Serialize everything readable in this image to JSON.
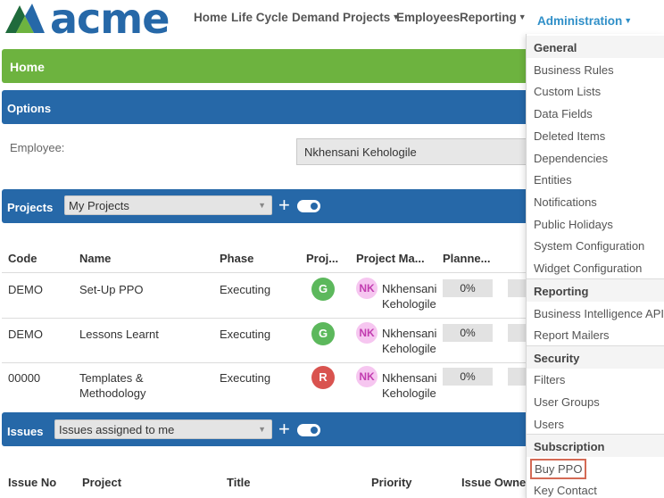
{
  "brand": {
    "logo_text": "acme",
    "logo_icon": "acme-triangle-logo"
  },
  "nav": {
    "home": "Home",
    "life_cycle": "Life Cycle",
    "demand_projects": "Demand Projects",
    "employees": "Employees",
    "reporting": "Reporting",
    "administration": "Administration"
  },
  "home_title": "Home",
  "options": {
    "title": "Options",
    "employee_label": "Employee:",
    "employee_value": "Nkhensani Kehologile"
  },
  "projects": {
    "title": "Projects",
    "filter": "My Projects",
    "columns": [
      "Code",
      "Name",
      "Phase",
      "Proj...",
      "Project Ma...",
      "Planne..."
    ],
    "rows": [
      {
        "code": "DEMO",
        "name_1": "Set-Up PPO",
        "name_2": "",
        "phase": "Executing",
        "status": "G",
        "pm_initials": "NK",
        "pm_first": "Nkhensani",
        "pm_last": "Kehologile",
        "planned": "0%"
      },
      {
        "code": "DEMO",
        "name_1": "Lessons Learnt",
        "name_2": "",
        "phase": "Executing",
        "status": "G",
        "pm_initials": "NK",
        "pm_first": "Nkhensani",
        "pm_last": "Kehologile",
        "planned": "0%"
      },
      {
        "code": "00000",
        "name_1": "Templates &",
        "name_2": "Methodology",
        "phase": "Executing",
        "status": "R",
        "pm_initials": "NK",
        "pm_first": "Nkhensani",
        "pm_last": "Kehologile",
        "planned": "0%"
      }
    ]
  },
  "issues": {
    "title": "Issues",
    "filter": "Issues assigned to me",
    "columns": [
      "Issue No",
      "Project",
      "Title",
      "Priority",
      "Issue Owner"
    ]
  },
  "admin_menu": {
    "general": {
      "header": "General",
      "items": [
        "Business Rules",
        "Custom Lists",
        "Data Fields",
        "Deleted Items",
        "Dependencies",
        "Entities",
        "Notifications",
        "Public Holidays",
        "System Configuration",
        "Widget Configuration"
      ]
    },
    "reporting": {
      "header": "Reporting",
      "items": [
        "Business Intelligence API",
        "Report Mailers"
      ]
    },
    "security": {
      "header": "Security",
      "items": [
        "Filters",
        "User Groups",
        "Users"
      ]
    },
    "subscription": {
      "header": "Subscription",
      "items": [
        "Buy PPO",
        "Key Contact"
      ]
    }
  },
  "colors": {
    "brand_blue": "#2668a8",
    "home_green": "#6db33f",
    "status_green": "#5cb85c",
    "status_red": "#d9534f",
    "highlight_outline": "#d46a55"
  }
}
